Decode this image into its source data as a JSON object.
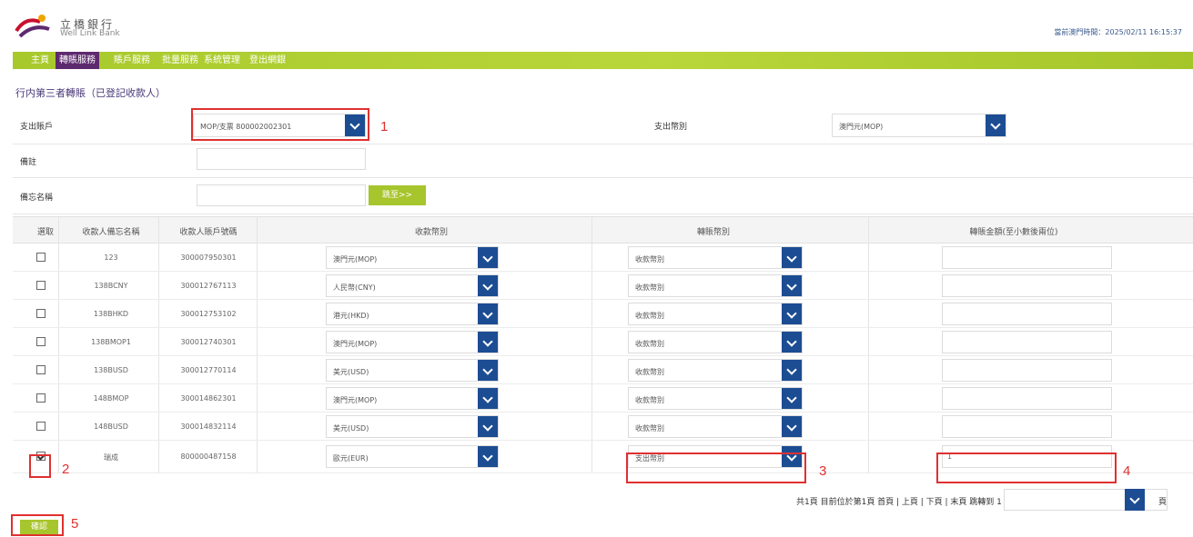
{
  "brand": {
    "name_cn": "立橋銀行",
    "name_en": "Well Link Bank",
    "logo_colors": [
      "#c8102e",
      "#5e2a6e",
      "#f0a500"
    ]
  },
  "header": {
    "login_time": "當前澳門時間：2025/02/11 16:15:37"
  },
  "menu": [
    {
      "label": "主頁",
      "active": false
    },
    {
      "label": "轉賬服務",
      "active": true
    },
    {
      "label": "賬戶服務",
      "active": false
    },
    {
      "label": "批量服務",
      "active": false
    },
    {
      "label": "系統管理",
      "active": false
    },
    {
      "label": "登出網銀",
      "active": false
    }
  ],
  "page_title": "行内第三者轉賬（已登記收款人）",
  "form": {
    "debit_account": {
      "label": "支出賬戶",
      "value": "MOP/支票 800002002301"
    },
    "debit_currency": {
      "label": "支出幣別",
      "value": "澳門元(MOP)"
    },
    "remark": {
      "label": "備註",
      "value": ""
    },
    "payee_alias": {
      "label": "備忘名稱",
      "value": "",
      "button": "跳至>>"
    }
  },
  "table": {
    "headers": {
      "select": "選取",
      "alias": "收款人備忘名稱",
      "account": "收款人賬戶號碼",
      "receive_currency": "收款幣別",
      "transfer_currency": "轉賬幣別",
      "amount": "轉賬金額(至小數後兩位)"
    },
    "rows": [
      {
        "checked": false,
        "alias": "123",
        "account": "300007950301",
        "receive_currency": "澳門元(MOP)",
        "transfer_currency": "收款幣別",
        "amount": ""
      },
      {
        "checked": false,
        "alias": "138BCNY",
        "account": "300012767113",
        "receive_currency": "人民幣(CNY)",
        "transfer_currency": "收款幣別",
        "amount": ""
      },
      {
        "checked": false,
        "alias": "138BHKD",
        "account": "300012753102",
        "receive_currency": "港元(HKD)",
        "transfer_currency": "收款幣別",
        "amount": ""
      },
      {
        "checked": false,
        "alias": "138BMOP1",
        "account": "300012740301",
        "receive_currency": "澳門元(MOP)",
        "transfer_currency": "收款幣別",
        "amount": ""
      },
      {
        "checked": false,
        "alias": "138BUSD",
        "account": "300012770114",
        "receive_currency": "美元(USD)",
        "transfer_currency": "收款幣別",
        "amount": ""
      },
      {
        "checked": false,
        "alias": "148BMOP",
        "account": "300014862301",
        "receive_currency": "澳門元(MOP)",
        "transfer_currency": "收款幣別",
        "amount": ""
      },
      {
        "checked": false,
        "alias": "148BUSD",
        "account": "300014832114",
        "receive_currency": "美元(USD)",
        "transfer_currency": "收款幣別",
        "amount": ""
      },
      {
        "checked": true,
        "alias": "瑞成",
        "account": "800000487158",
        "receive_currency": "歐元(EUR)",
        "transfer_currency": "支出幣別",
        "amount": "1"
      }
    ]
  },
  "pager": {
    "text": "共1頁  目前位於第1頁  首頁 | 上頁 | 下頁 | 末頁  跳轉到 1",
    "tail": "頁"
  },
  "confirm_button": "確認",
  "annotations": [
    "1",
    "2",
    "3",
    "4",
    "5"
  ],
  "colors": {
    "accent_green": "#a7c52c",
    "menu_active": "#5e2a6e",
    "select_arrow": "#1c4d93",
    "annotation": "#e03030"
  }
}
